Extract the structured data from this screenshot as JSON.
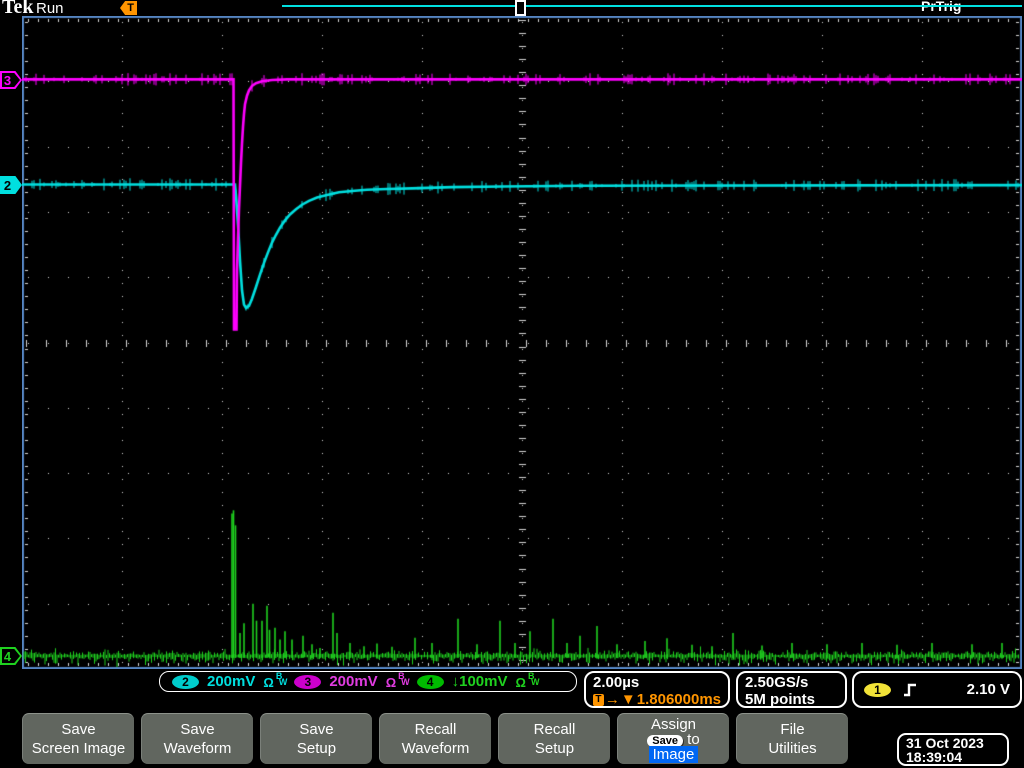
{
  "header": {
    "logo": "Tek",
    "acq_status": "Run",
    "trigger_status": "PrTrig"
  },
  "markers": {
    "trigger_flag": "T"
  },
  "colors": {
    "ch2": "#00e0e0",
    "ch3": "#ff00ff",
    "ch4": "#1fd11f",
    "ch1": "#f2e338",
    "accent_orange": "#ff9500",
    "graticule_border": "#5585c2",
    "highlight_blue": "#0067f4"
  },
  "chart_data": {
    "type": "line",
    "title": "Oscilloscope waveform display",
    "x_axis": {
      "scale_per_div": "2.00µs",
      "divisions": 10,
      "total_span": "20µs",
      "trigger_delay": "1.806000ms"
    },
    "y_axis": {
      "divisions": 10
    },
    "grid": {
      "dotted_divisions": true,
      "center_cross_ticks": true,
      "edge_ticks": true
    },
    "series": [
      {
        "name": "CH2",
        "color": "#00e0e0",
        "volts_per_div": "200mV",
        "baseline_div": 2.58,
        "noise_div": 0.05,
        "points_div": [
          [
            0,
            2.58
          ],
          [
            2.13,
            2.58
          ],
          [
            2.14,
            2.75
          ],
          [
            2.16,
            3.2
          ],
          [
            2.18,
            3.75
          ],
          [
            2.2,
            4.2
          ],
          [
            2.22,
            4.42
          ],
          [
            2.24,
            4.47
          ],
          [
            2.27,
            4.44
          ],
          [
            2.3,
            4.33
          ],
          [
            2.34,
            4.15
          ],
          [
            2.38,
            3.96
          ],
          [
            2.42,
            3.78
          ],
          [
            2.46,
            3.62
          ],
          [
            2.5,
            3.47
          ],
          [
            2.54,
            3.35
          ],
          [
            2.58,
            3.24
          ],
          [
            2.63,
            3.13
          ],
          [
            2.68,
            3.04
          ],
          [
            2.74,
            2.96
          ],
          [
            2.8,
            2.89
          ],
          [
            2.87,
            2.83
          ],
          [
            2.95,
            2.78
          ],
          [
            3.05,
            2.74
          ],
          [
            3.17,
            2.7
          ],
          [
            3.3,
            2.68
          ],
          [
            3.45,
            2.66
          ],
          [
            3.65,
            2.65
          ],
          [
            3.9,
            2.64
          ],
          [
            4.3,
            2.62
          ],
          [
            4.8,
            2.61
          ],
          [
            5.6,
            2.6
          ],
          [
            10,
            2.59
          ]
        ]
      },
      {
        "name": "CH3",
        "color": "#ff00ff",
        "volts_per_div": "200mV",
        "baseline_div": 0.97,
        "noise_div": 0.05,
        "points_div": [
          [
            0,
            0.97
          ],
          [
            2.115,
            0.97
          ],
          [
            2.12,
            4.8
          ],
          [
            2.145,
            4.8
          ],
          [
            2.15,
            3.9
          ],
          [
            2.16,
            3.4
          ],
          [
            2.17,
            2.95
          ],
          [
            2.18,
            2.6
          ],
          [
            2.19,
            2.25
          ],
          [
            2.2,
            1.95
          ],
          [
            2.21,
            1.7
          ],
          [
            2.22,
            1.5
          ],
          [
            2.23,
            1.35
          ],
          [
            2.25,
            1.22
          ],
          [
            2.27,
            1.14
          ],
          [
            2.3,
            1.07
          ],
          [
            2.34,
            1.03
          ],
          [
            2.4,
            1.0
          ],
          [
            2.5,
            0.98
          ],
          [
            2.65,
            0.97
          ],
          [
            10,
            0.97
          ]
        ]
      },
      {
        "name": "CH4",
        "color": "#1fd11f",
        "volts_per_div": "100mV",
        "baseline_div": 9.8,
        "noise_div": 0.09,
        "render": "spikes",
        "spikes_div": [
          [
            2.1,
            7.62
          ],
          [
            2.115,
            7.57
          ],
          [
            2.135,
            7.8
          ],
          [
            2.18,
            9.45
          ],
          [
            2.22,
            9.3
          ],
          [
            2.31,
            9.0
          ],
          [
            2.345,
            9.26
          ],
          [
            2.4,
            9.26
          ],
          [
            2.45,
            9.03
          ],
          [
            2.475,
            9.4
          ],
          [
            2.53,
            9.37
          ],
          [
            2.58,
            9.55
          ],
          [
            2.63,
            9.42
          ],
          [
            2.7,
            9.55
          ],
          [
            2.81,
            9.49
          ],
          [
            2.9,
            9.62
          ],
          [
            2.98,
            9.68
          ],
          [
            3.11,
            9.14
          ],
          [
            3.15,
            9.45
          ],
          [
            3.28,
            9.6
          ],
          [
            3.42,
            9.65
          ],
          [
            3.55,
            9.61
          ],
          [
            3.7,
            9.66
          ],
          [
            3.93,
            9.52
          ],
          [
            4.1,
            9.6
          ],
          [
            4.36,
            9.23
          ],
          [
            4.55,
            9.62
          ],
          [
            4.78,
            9.26
          ],
          [
            4.93,
            9.6
          ],
          [
            5.08,
            9.42
          ],
          [
            5.31,
            9.23
          ],
          [
            5.45,
            9.6
          ],
          [
            5.58,
            9.49
          ],
          [
            5.75,
            9.34
          ],
          [
            5.95,
            9.62
          ],
          [
            6.23,
            9.57
          ],
          [
            6.45,
            9.53
          ],
          [
            6.7,
            9.63
          ],
          [
            6.9,
            9.65
          ],
          [
            7.11,
            9.45
          ],
          [
            7.4,
            9.64
          ],
          [
            7.7,
            9.6
          ],
          [
            8.05,
            9.62
          ],
          [
            8.4,
            9.6
          ],
          [
            8.75,
            9.63
          ],
          [
            9.1,
            9.6
          ],
          [
            9.5,
            9.62
          ],
          [
            9.8,
            9.6
          ]
        ]
      }
    ]
  },
  "readouts": {
    "channels": [
      {
        "id": "2",
        "prefix": "",
        "scale": "200mV",
        "impedance": "Ω",
        "bw_sup": "B",
        "bw_sub": "W"
      },
      {
        "id": "3",
        "prefix": "",
        "scale": "200mV",
        "impedance": "Ω",
        "bw_sup": "B",
        "bw_sub": "W"
      },
      {
        "id": "4",
        "prefix": "↓",
        "scale": "100mV",
        "impedance": "Ω",
        "bw_sup": "B",
        "bw_sub": "W"
      }
    ],
    "timebase": {
      "scale": "2.00µs",
      "delay_arrow": "→",
      "delay_marker": "▼",
      "delay": "1.806000ms"
    },
    "acquisition": {
      "sample_rate": "2.50GS/s",
      "record_length": "5M points"
    },
    "trigger": {
      "source": "1",
      "level": "2.10 V",
      "slope": "rising"
    }
  },
  "menu": {
    "buttons": [
      {
        "line1": "Save",
        "line2": "Screen Image"
      },
      {
        "line1": "Save",
        "line2": "Waveform"
      },
      {
        "line1": "Save",
        "line2": "Setup"
      },
      {
        "line1": "Recall",
        "line2": "Waveform"
      },
      {
        "line1": "Recall",
        "line2": "Setup"
      },
      {
        "line1": "Assign",
        "pill": "Save",
        "suffix": "to",
        "target": "Image"
      },
      {
        "line1": "File",
        "line2": "Utilities"
      }
    ]
  },
  "clock": {
    "date": "31 Oct 2023",
    "time": "18:39:04"
  }
}
